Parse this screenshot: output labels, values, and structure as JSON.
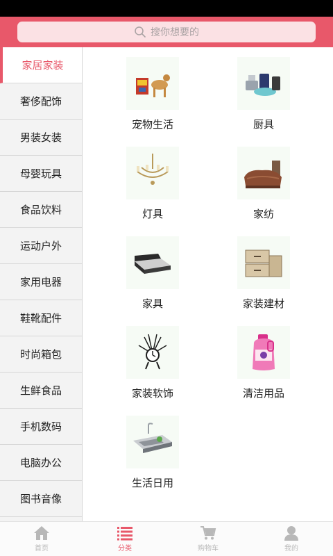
{
  "search": {
    "placeholder": "搜你想要的",
    "icon": "search-icon"
  },
  "sidebar": {
    "items": [
      {
        "label": "家居家装",
        "active": true
      },
      {
        "label": "奢侈配饰"
      },
      {
        "label": "男装女装"
      },
      {
        "label": "母婴玩具"
      },
      {
        "label": "食品饮料"
      },
      {
        "label": "运动户外"
      },
      {
        "label": "家用电器"
      },
      {
        "label": "鞋靴配件"
      },
      {
        "label": "时尚箱包"
      },
      {
        "label": "生鲜食品"
      },
      {
        "label": "手机数码"
      },
      {
        "label": "电脑办公"
      },
      {
        "label": "图书音像"
      }
    ]
  },
  "content": {
    "items": [
      {
        "label": "宠物生活",
        "icon": "pet-icon"
      },
      {
        "label": "厨具",
        "icon": "cookware-icon"
      },
      {
        "label": "灯具",
        "icon": "chandelier-icon"
      },
      {
        "label": "家纺",
        "icon": "bedding-icon"
      },
      {
        "label": "家具",
        "icon": "furniture-icon"
      },
      {
        "label": "家装建材",
        "icon": "drawer-cabinet-icon"
      },
      {
        "label": "家装软饰",
        "icon": "decor-clock-icon"
      },
      {
        "label": "清洁用品",
        "icon": "detergent-icon"
      },
      {
        "label": "生活日用",
        "icon": "sink-icon"
      }
    ]
  },
  "tabbar": {
    "items": [
      {
        "label": "首页",
        "icon": "home-icon"
      },
      {
        "label": "分类",
        "icon": "list-icon",
        "active": true
      },
      {
        "label": "购物车",
        "icon": "cart-icon"
      },
      {
        "label": "我的",
        "icon": "user-icon"
      }
    ]
  },
  "colors": {
    "accent": "#e8586a",
    "search_bg": "#fbe1e4",
    "inactive": "#b8b8b8"
  }
}
